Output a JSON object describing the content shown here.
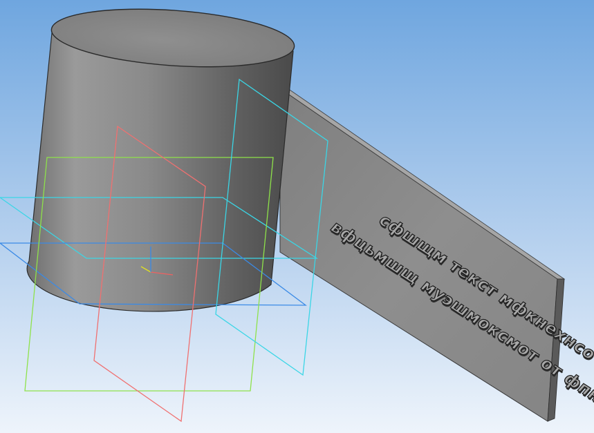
{
  "viewport": {
    "background_top": "#6fa6df",
    "background_bottom": "#e9f1fa"
  },
  "model": {
    "embossed_text": {
      "line1": "сфшщм текст мфкнехнсо",
      "line2": "вфцьмшщ муэшмоксмот от фпнснко"
    }
  },
  "colors": {
    "plane_front": "#8ee24a",
    "plane_right": "#f07070",
    "plane_side": "#3ad6e6",
    "plane_top": "#3a8ae6",
    "axis_x": "#f06060",
    "axis_y": "#e0e020",
    "axis_z": "#3a8ae6",
    "body_gray": "#8c8c8c",
    "edge_dark": "#2a2a2a"
  }
}
